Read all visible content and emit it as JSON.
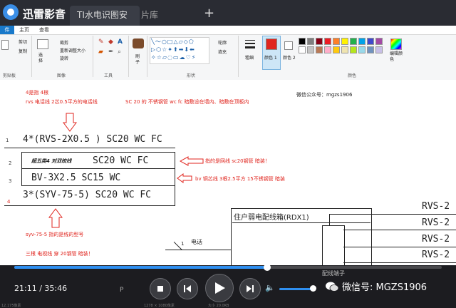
{
  "player": {
    "app_name": "迅雷影音",
    "tabs": [
      {
        "label": "TI水电识图安"
      },
      {
        "label": "片库"
      }
    ],
    "add_tab": "+",
    "current_time": "21:11",
    "total_time": "35:46",
    "time_separator": " / ",
    "progress": 0.592,
    "volume": 1.0,
    "watermark": "微信号: MGZS1906"
  },
  "paint": {
    "menu": [
      "件",
      "主页",
      "查看"
    ],
    "groups": {
      "clipboard": {
        "label": "剪贴板",
        "items": [
          "剪切",
          "复制"
        ]
      },
      "image": {
        "label": "图像",
        "items": [
          "选",
          "择",
          "裁剪",
          "重新调整大小",
          "旋转"
        ]
      },
      "tools": {
        "label": "工具",
        "items": []
      },
      "brush": {
        "label": "刷子",
        "items": [
          "刷",
          "子"
        ]
      },
      "shapes": {
        "label": "形状",
        "items": [
          "轮廓",
          "填充"
        ]
      },
      "size": {
        "label": "粗细",
        "items": []
      },
      "color1": {
        "label": "颜色 1",
        "items": []
      },
      "color2": {
        "label": "颜色 2",
        "items": []
      },
      "colors": {
        "label": "颜色",
        "items": []
      },
      "edit_colors": {
        "label": "编辑颜色",
        "items": []
      }
    },
    "palette": [
      "#000000",
      "#7f7f7f",
      "#880015",
      "#ed1c24",
      "#ff7f27",
      "#fff200",
      "#22b14c",
      "#00a2e8",
      "#3f48cc",
      "#a349a4",
      "#ffffff",
      "#c3c3c3",
      "#b97a57",
      "#ffaec9",
      "#ffc90e",
      "#efe4b0",
      "#b5e61d",
      "#99d9ea",
      "#7092be",
      "#c8bfe7"
    ],
    "color1": "#e0261f",
    "color2": "#ffffff"
  },
  "canvas": {
    "annotations": {
      "a1": "4是指 4根",
      "a2": "rvs  电话线   2芯0.5平方的电话线",
      "a3": "SC  20  的 不锈钢管  wc  fc   暗敷设在墙内、暗敷在顶板内",
      "wechat": "微信公众号：mgzs1906",
      "a4": "指的是网线  sc20钢管  暗装！",
      "a5": "bv 铜芯线   3根2.5平方  15不锈钢管  暗装",
      "a6": "syv-75-5  指的是线的型号",
      "a7": "三根 电视线 穿 20钢管  暗装！"
    },
    "row_numbers": [
      "1",
      "2",
      "3",
      "4"
    ],
    "lines": {
      "l1": "4*(RVS-2X0.5 ) SC20  WC  FC",
      "l2_prefix": "超五类4 对双绞线",
      "l2_rest": "SC20  WC  FC",
      "l3": "BV-3X2.5  SC15  WC",
      "l4": "3*(SYV-75-5)  SC20  WC  FC"
    },
    "box_title": "住户弱电配线箱(RDX1)",
    "rvs_labels": [
      "RVS-2",
      "RVS-2",
      "RVS-2",
      "RVS-2"
    ],
    "phone_label": "电话",
    "phone_num": "1",
    "distributor": "配线端子",
    "p_label": "P"
  },
  "status": {
    "left": "12.175像素",
    "mid": "1278 × 1080像素",
    "right": "大小 20.0KB"
  }
}
